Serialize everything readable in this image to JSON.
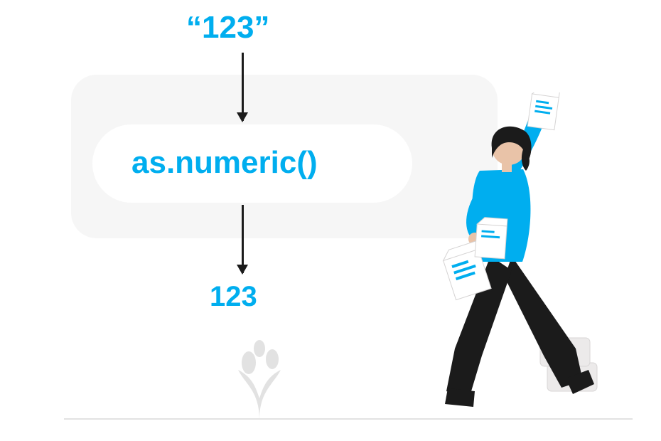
{
  "diagram": {
    "input_value": "“123”",
    "function_name": "as.numeric()",
    "output_value": "123"
  },
  "colors": {
    "primary_text": "#00aeef",
    "accent": "#00aeef",
    "figure_dark": "#1b1b1b",
    "figure_skin": "#e9c3a8",
    "neutral_bg": "#f6f6f6"
  }
}
